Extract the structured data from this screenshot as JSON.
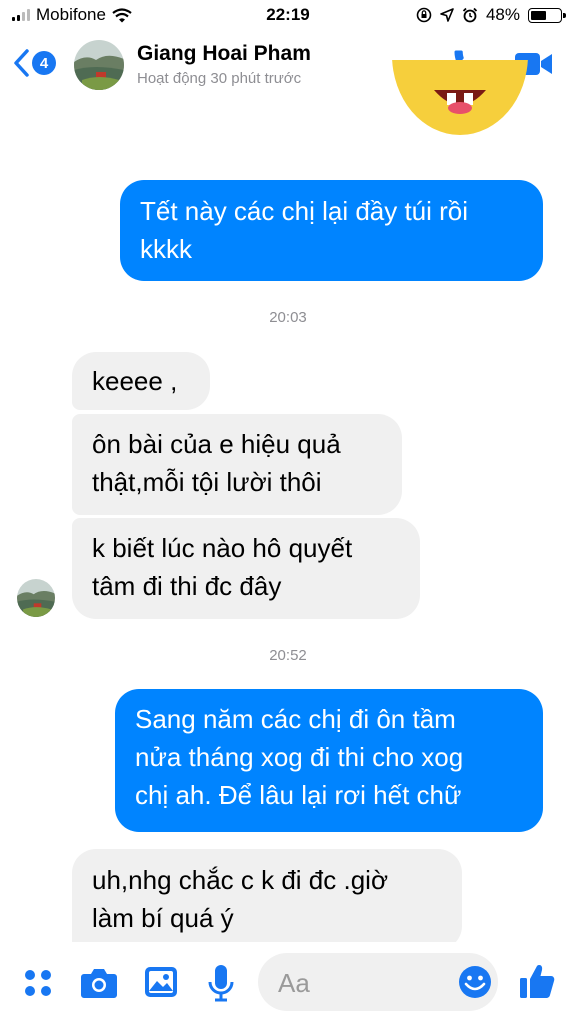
{
  "status_bar": {
    "carrier": "Mobifone",
    "time": "22:19",
    "battery": "48%"
  },
  "header": {
    "back_badge": "4",
    "contact_name": "Giang Hoai Pham",
    "activity_status": "Hoạt động 30 phút trước"
  },
  "messages": [
    {
      "id": "m1",
      "from": "me",
      "lines": [
        "Tết này các chị lại đầy túi rồi",
        "kkkk"
      ]
    },
    {
      "id": "t1",
      "timestamp": "20:03"
    },
    {
      "id": "m2",
      "from": "contact",
      "lines": [
        "keeee ,"
      ]
    },
    {
      "id": "m3",
      "from": "contact",
      "lines": [
        "ôn bài của e hiệu quả",
        "thật,mỗi tội lười thôi"
      ]
    },
    {
      "id": "m4",
      "from": "contact",
      "lines": [
        "k biết lúc nào hô quyết",
        "tâm đi thi đc đây"
      ]
    },
    {
      "id": "t2",
      "timestamp": "20:52"
    },
    {
      "id": "m5",
      "from": "me",
      "lines": [
        "Sang năm các chị đi ôn tầm",
        "nửa tháng xog đi thi cho xog",
        "chị ah. Để lâu lại rơi hết chữ"
      ]
    },
    {
      "id": "m6",
      "from": "contact",
      "lines": [
        "uh,nhg chắc c k đi đc .giờ",
        "làm bí quá ý"
      ]
    }
  ],
  "composer": {
    "placeholder": "Aa"
  },
  "colors": {
    "accent": "#0084ff",
    "incoming_bubble": "#f0f0f0",
    "timestamp": "#8e8e93"
  },
  "icons": [
    "back-chevron-icon",
    "phone-icon",
    "video-camera-icon",
    "apps-grid-icon",
    "camera-icon",
    "gallery-icon",
    "microphone-icon",
    "emoji-icon",
    "thumbs-up-icon"
  ]
}
